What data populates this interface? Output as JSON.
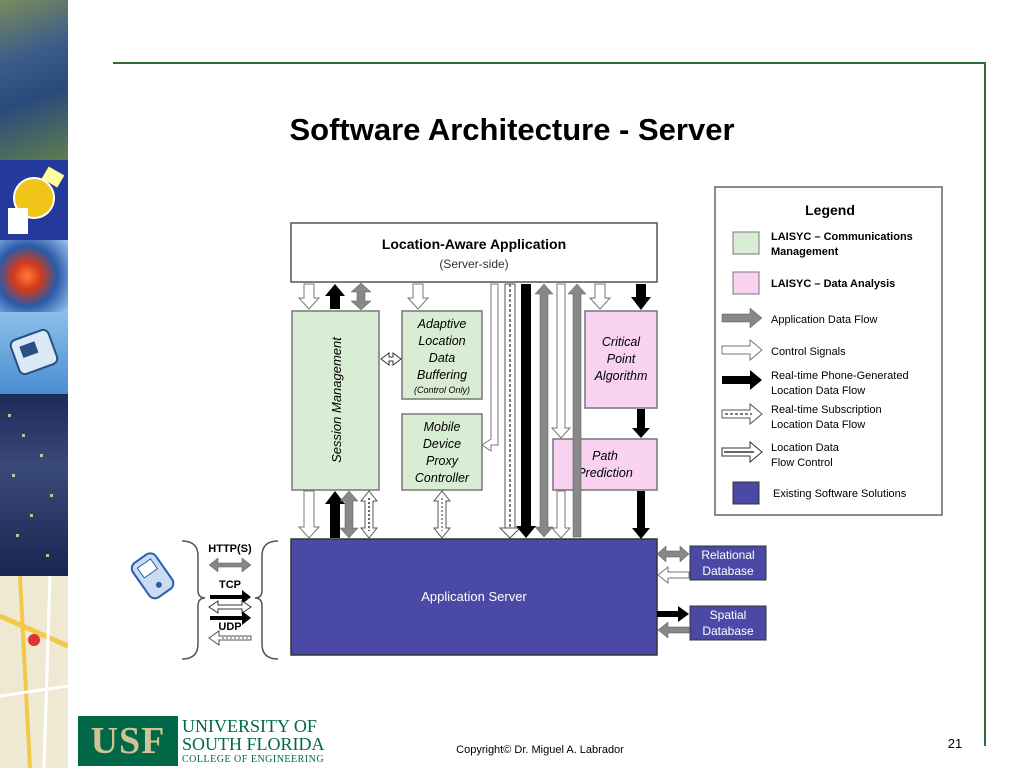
{
  "slide": {
    "title": "Software Architecture - Server",
    "number": "21",
    "copyright": "Copyright© Dr. Miguel A. Labrador"
  },
  "logo": {
    "letters": "USF",
    "line1": "UNIVERSITY OF",
    "line2": "SOUTH FLORIDA",
    "line3": "COLLEGE OF ENGINEERING"
  },
  "diagram": {
    "app_title": "Location-Aware Application",
    "app_subtitle": "(Server-side)",
    "session_management": "Session Management",
    "adaptive_buffering": [
      "Adaptive",
      "Location",
      "Data",
      "Buffering"
    ],
    "adaptive_note": "(Control Only)",
    "mobile_proxy": [
      "Mobile",
      "Device",
      "Proxy",
      "Controller"
    ],
    "critical_point": [
      "Critical",
      "Point",
      "Algorithm"
    ],
    "path_prediction": [
      "Path",
      "Prediction"
    ],
    "app_server": "Application Server",
    "relational_db": [
      "Relational",
      "Database"
    ],
    "spatial_db": [
      "Spatial",
      "Database"
    ],
    "protocols": [
      "HTTP(S)",
      "TCP",
      "UDP"
    ]
  },
  "legend": {
    "title": "Legend",
    "items": [
      {
        "lines": [
          "LAISYC – Communications",
          "Management"
        ],
        "bold": true
      },
      {
        "lines": [
          "LAISYC – Data Analysis"
        ],
        "bold": true
      },
      {
        "lines": [
          "Application Data Flow"
        ],
        "bold": false
      },
      {
        "lines": [
          "Control Signals"
        ],
        "bold": false
      },
      {
        "lines": [
          "Real-time Phone-Generated",
          "Location Data Flow"
        ],
        "bold": false
      },
      {
        "lines": [
          "Real-time Subscription",
          "Location Data Flow"
        ],
        "bold": false
      },
      {
        "lines": [
          "Location Data",
          "Flow Control"
        ],
        "bold": false
      },
      {
        "lines": [
          "Existing Software Solutions"
        ],
        "bold": false
      }
    ]
  },
  "colors": {
    "green_box": "#d9ecd4",
    "pink_box": "#f8d2f0",
    "blue_box": "#4a4aa6",
    "frame": "#2e6b3a",
    "usf_green": "#006747",
    "usf_gold": "#cfc493"
  }
}
